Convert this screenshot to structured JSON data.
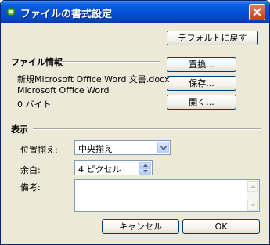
{
  "window": {
    "title": "ファイルの書式設定",
    "icon": "gear-app-icon"
  },
  "buttons": {
    "default": "デフォルトに戻す",
    "replace": "置換...",
    "save": "保存...",
    "open": "開く...",
    "cancel": "キャンセル",
    "ok": "OK"
  },
  "file_info": {
    "heading": "ファイル情報",
    "name": "新規Microsoft Office Word 文書.docx",
    "type": "Microsoft Office Word",
    "size": "0 バイト"
  },
  "display": {
    "heading": "表示",
    "position": {
      "label": "位置揃え:",
      "value": "中央揃え"
    },
    "margin": {
      "label": "余白:",
      "value": "4 ピクセル"
    },
    "note": {
      "label": "備考:",
      "value": ""
    }
  },
  "colors": {
    "titlebar": "#0550d8",
    "face": "#ece9d8",
    "field_border": "#7f9db9"
  }
}
